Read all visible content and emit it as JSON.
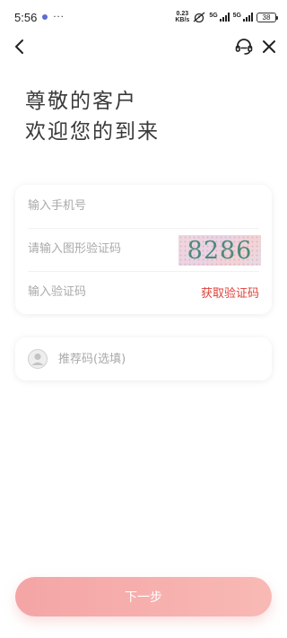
{
  "status_bar": {
    "time": "5:56",
    "more": "···",
    "net_speed_value": "0.23",
    "net_speed_unit": "KB/s",
    "sig1_label": "5G",
    "sig2_label": "5G",
    "battery": "38"
  },
  "nav": {
    "back_icon": "chevron-left-icon",
    "service_icon": "headset-icon",
    "close_icon": "close-icon"
  },
  "greeting": {
    "line1": "尊敬的客户",
    "line2": "欢迎您的到来"
  },
  "form": {
    "phone_placeholder": "输入手机号",
    "phone_value": "",
    "captcha_placeholder": "请输入图形验证码",
    "captcha_value": "",
    "captcha_image_text": "8286",
    "sms_placeholder": "输入验证码",
    "sms_value": "",
    "get_code_label": "获取验证码"
  },
  "referral": {
    "placeholder": "推荐码(选填)",
    "value": ""
  },
  "next_button": {
    "label": "下一步"
  },
  "colors": {
    "accent_red": "#e0413b",
    "button_gradient_start": "#f4a5a5",
    "button_gradient_end": "#f8b9b4",
    "captcha_digits": "#4d8a7c"
  }
}
